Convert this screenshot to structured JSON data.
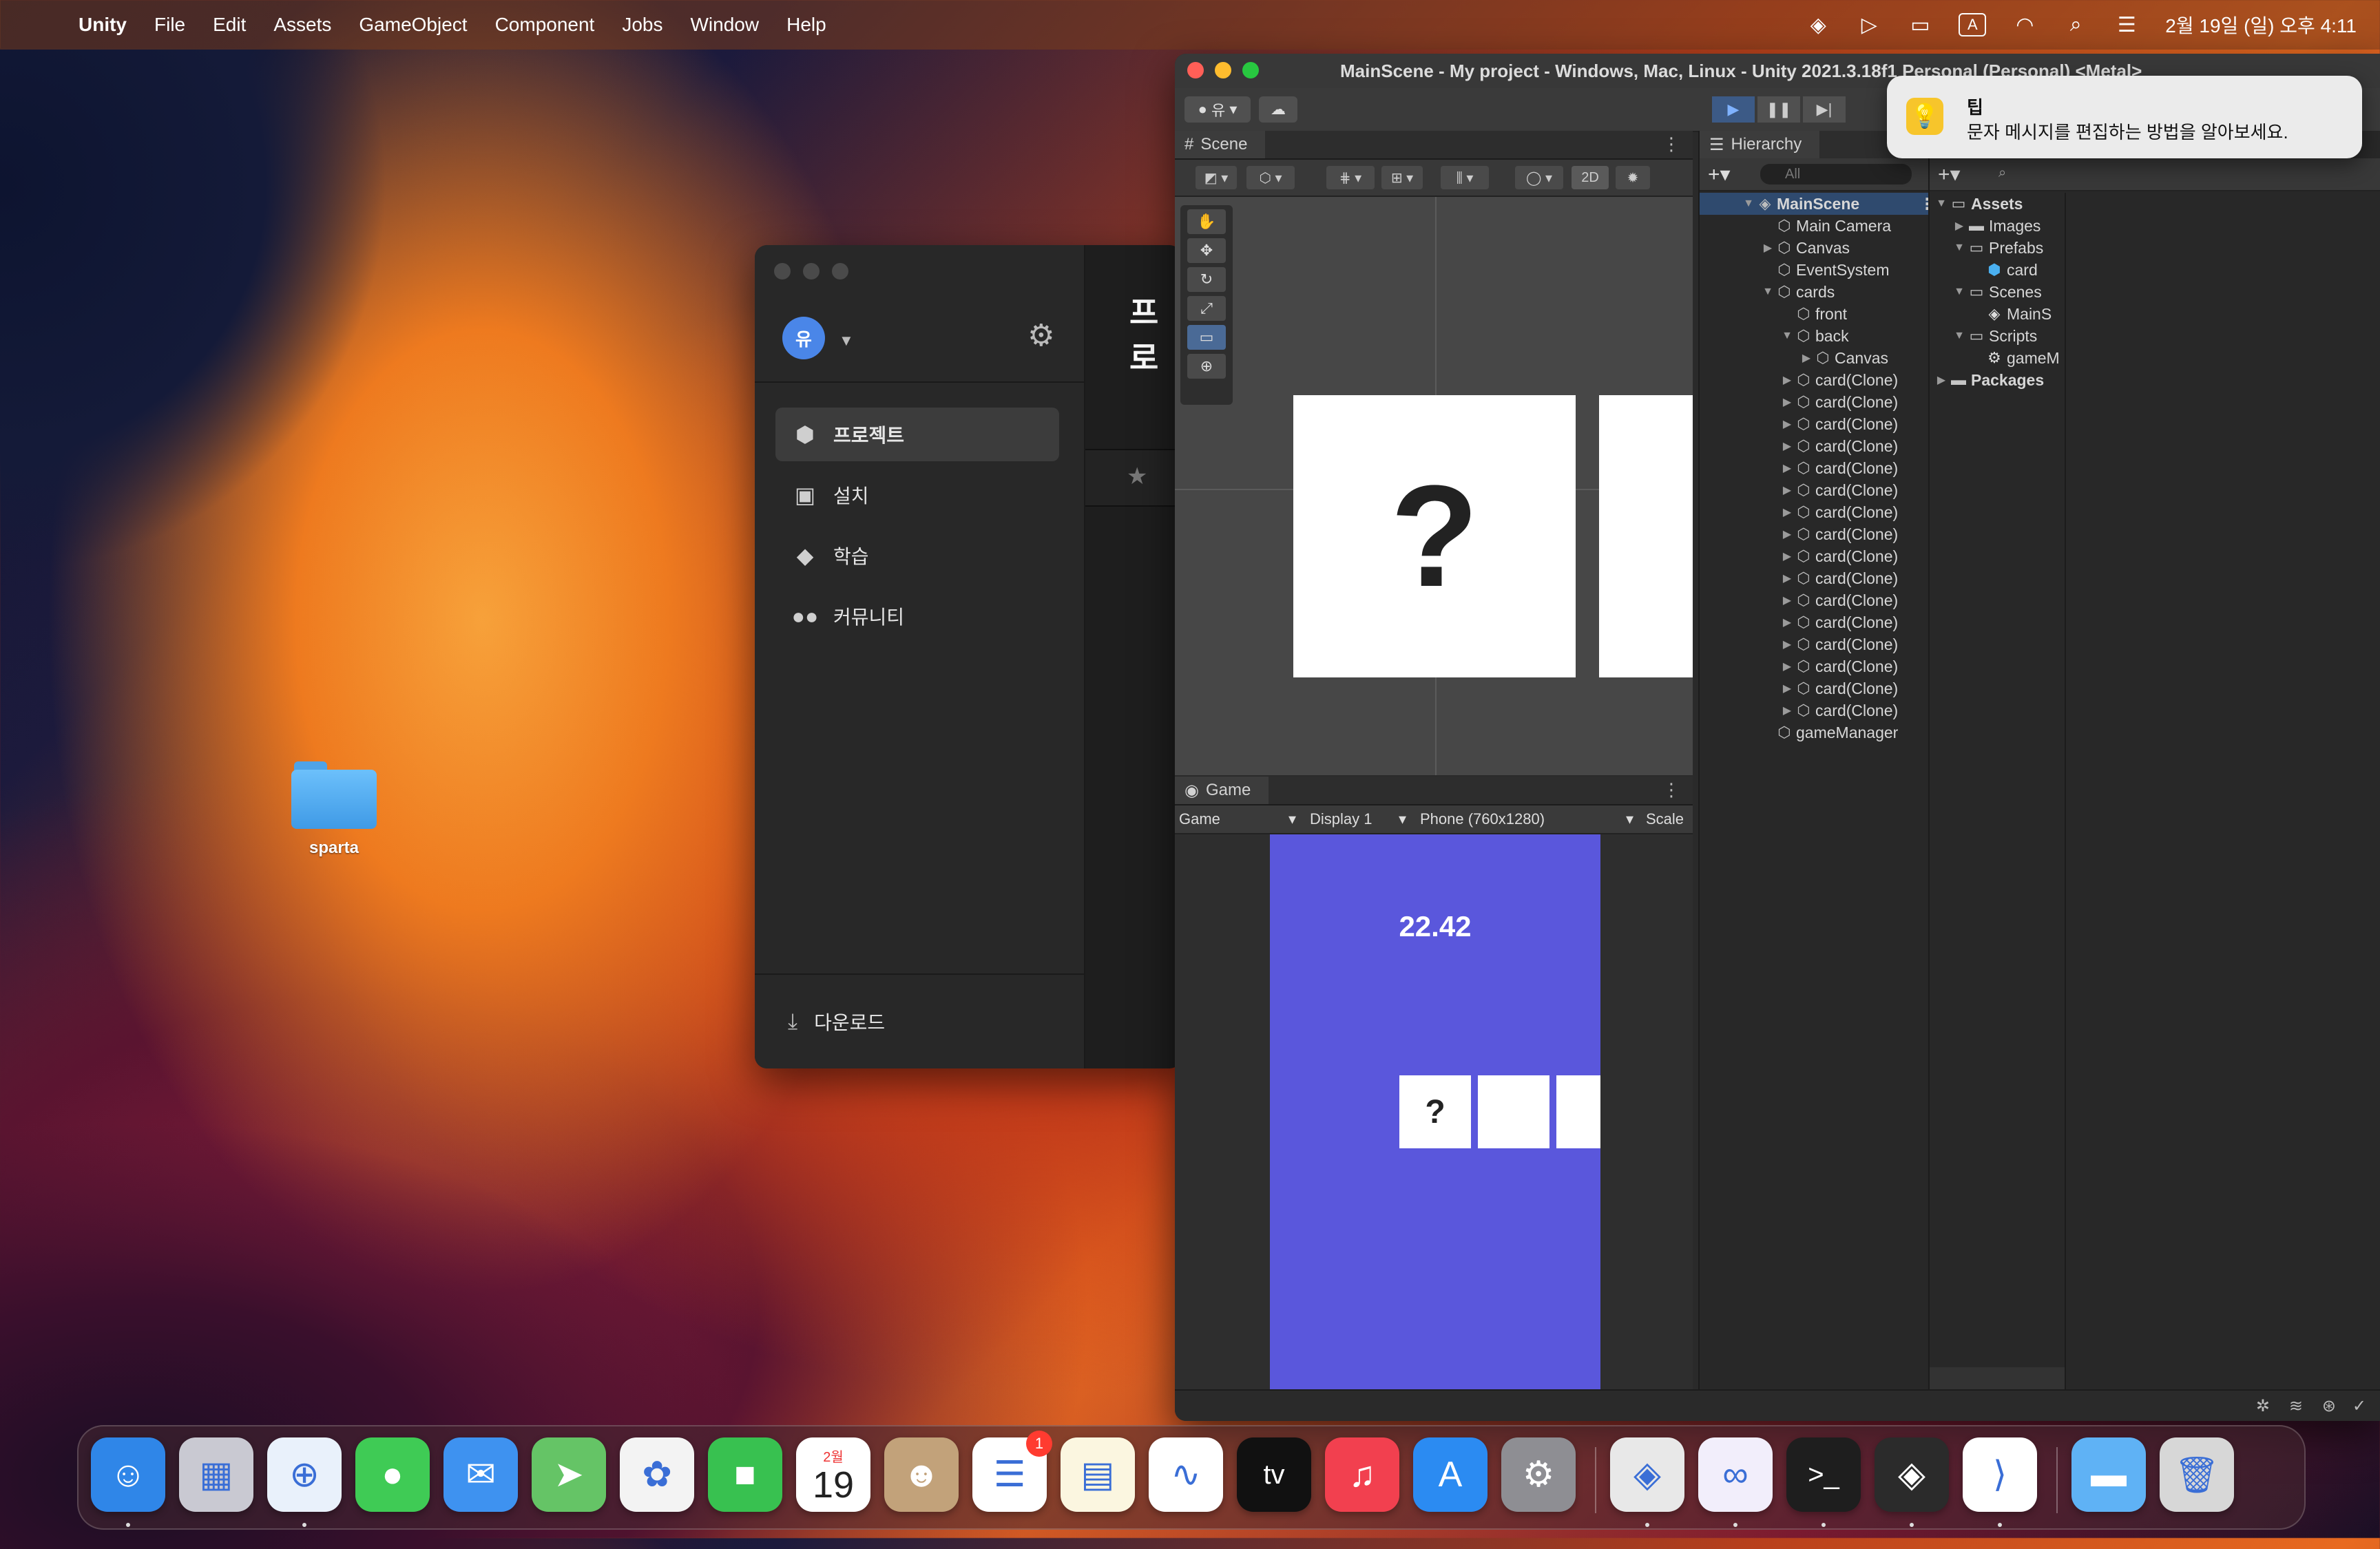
{
  "menubar": {
    "app": "Unity",
    "items": [
      "File",
      "Edit",
      "Assets",
      "GameObject",
      "Component",
      "Jobs",
      "Window",
      "Help"
    ],
    "input_indicator": "A",
    "datetime": "2월 19일 (일) 오후 4:11"
  },
  "desktop": {
    "folder_label": "sparta"
  },
  "hub": {
    "avatar_initial": "유",
    "title_partial": "프로",
    "nav": [
      {
        "label": "프로젝트",
        "icon": "cube-icon",
        "active": true
      },
      {
        "label": "설치",
        "icon": "lock-icon",
        "active": false
      },
      {
        "label": "학습",
        "icon": "graduation-cap-icon",
        "active": false
      },
      {
        "label": "커뮤니티",
        "icon": "people-icon",
        "active": false
      }
    ],
    "download_label": "다운로드"
  },
  "editor": {
    "title": "MainScene - My project - Windows, Mac, Linux - Unity 2021.3.18f1 Personal (Personal) <Metal>",
    "account_label": "유",
    "scene_tab": "Scene",
    "mode_2d": "2D",
    "game_tab": "Game",
    "game_bar": {
      "view": "Game",
      "display": "Display 1",
      "resolution": "Phone (760x1280)",
      "scale": "Scale"
    },
    "game": {
      "timer": "22.42",
      "card_symbol": "?"
    },
    "scene_card_symbol": "?",
    "hierarchy_tab": "Hierarchy",
    "hierarchy_search": "All",
    "hierarchy": [
      {
        "label": "MainScene",
        "depth": 0,
        "arrow": "▼",
        "scene": true
      },
      {
        "label": "Main Camera",
        "depth": 1,
        "arrow": ""
      },
      {
        "label": "Canvas",
        "depth": 1,
        "arrow": "▶"
      },
      {
        "label": "EventSystem",
        "depth": 1,
        "arrow": ""
      },
      {
        "label": "cards",
        "depth": 1,
        "arrow": "▼"
      },
      {
        "label": "front",
        "depth": 2,
        "arrow": ""
      },
      {
        "label": "back",
        "depth": 2,
        "arrow": "▼"
      },
      {
        "label": "Canvas",
        "depth": 3,
        "arrow": "▶"
      },
      {
        "label": "card(Clone)",
        "depth": 2,
        "arrow": "▶"
      },
      {
        "label": "card(Clone)",
        "depth": 2,
        "arrow": "▶"
      },
      {
        "label": "card(Clone)",
        "depth": 2,
        "arrow": "▶"
      },
      {
        "label": "card(Clone)",
        "depth": 2,
        "arrow": "▶"
      },
      {
        "label": "card(Clone)",
        "depth": 2,
        "arrow": "▶"
      },
      {
        "label": "card(Clone)",
        "depth": 2,
        "arrow": "▶"
      },
      {
        "label": "card(Clone)",
        "depth": 2,
        "arrow": "▶"
      },
      {
        "label": "card(Clone)",
        "depth": 2,
        "arrow": "▶"
      },
      {
        "label": "card(Clone)",
        "depth": 2,
        "arrow": "▶"
      },
      {
        "label": "card(Clone)",
        "depth": 2,
        "arrow": "▶"
      },
      {
        "label": "card(Clone)",
        "depth": 2,
        "arrow": "▶"
      },
      {
        "label": "card(Clone)",
        "depth": 2,
        "arrow": "▶"
      },
      {
        "label": "card(Clone)",
        "depth": 2,
        "arrow": "▶"
      },
      {
        "label": "card(Clone)",
        "depth": 2,
        "arrow": "▶"
      },
      {
        "label": "card(Clone)",
        "depth": 2,
        "arrow": "▶"
      },
      {
        "label": "card(Clone)",
        "depth": 2,
        "arrow": "▶"
      },
      {
        "label": "gameManager",
        "depth": 1,
        "arrow": ""
      }
    ],
    "project": [
      {
        "label": "Assets",
        "depth": 0,
        "arrow": "▼",
        "icon": "folder-open",
        "bold": true
      },
      {
        "label": "Images",
        "depth": 1,
        "arrow": "▶",
        "icon": "folder"
      },
      {
        "label": "Prefabs",
        "depth": 1,
        "arrow": "▼",
        "icon": "folder-open"
      },
      {
        "label": "card",
        "depth": 2,
        "arrow": "",
        "icon": "prefab"
      },
      {
        "label": "Scenes",
        "depth": 1,
        "arrow": "▼",
        "icon": "folder-open"
      },
      {
        "label": "MainS",
        "depth": 2,
        "arrow": "",
        "icon": "scene"
      },
      {
        "label": "Scripts",
        "depth": 1,
        "arrow": "▼",
        "icon": "folder-open"
      },
      {
        "label": "gameM",
        "depth": 2,
        "arrow": "",
        "icon": "script"
      },
      {
        "label": "Packages",
        "depth": 0,
        "arrow": "▶",
        "icon": "folder",
        "bold": true
      }
    ]
  },
  "notification": {
    "title": "팁",
    "message": "문자 메시지를 편집하는 방법을 알아보세요."
  },
  "dock": {
    "calendar_month": "2월",
    "calendar_day": "19",
    "reminders_badge": "1",
    "apps": [
      {
        "name": "finder-icon",
        "color": "#2f86e8",
        "glyph": "☺",
        "dot": true
      },
      {
        "name": "launchpad-icon",
        "color": "#c9c9d2",
        "glyph": "▦",
        "dot": false
      },
      {
        "name": "safari-icon",
        "color": "#e9f1fb",
        "glyph": "⊕",
        "dot": true
      },
      {
        "name": "messages-icon",
        "color": "#3fcb55",
        "glyph": "●",
        "dot": false
      },
      {
        "name": "mail-icon",
        "color": "#3e92f0",
        "glyph": "✉",
        "dot": false
      },
      {
        "name": "maps-icon",
        "color": "#65c466",
        "glyph": "➤",
        "dot": false
      },
      {
        "name": "photos-icon",
        "color": "#f3f3f3",
        "glyph": "✿",
        "dot": false
      },
      {
        "name": "facetime-icon",
        "color": "#38c150",
        "glyph": "■",
        "dot": false
      },
      {
        "name": "calendar-icon",
        "color": "#ffffff",
        "glyph": "",
        "dot": false
      },
      {
        "name": "contacts-icon",
        "color": "#c2a27a",
        "glyph": "☻",
        "dot": false
      },
      {
        "name": "reminders-icon",
        "color": "#ffffff",
        "glyph": "☰",
        "dot": false
      },
      {
        "name": "notes-icon",
        "color": "#fbf6e0",
        "glyph": "▤",
        "dot": false
      },
      {
        "name": "freeform-icon",
        "color": "#ffffff",
        "glyph": "∿",
        "dot": false
      },
      {
        "name": "apple-tv-icon",
        "color": "#111111",
        "glyph": "tv",
        "dot": false
      },
      {
        "name": "music-icon",
        "color": "#f2404f",
        "glyph": "♫",
        "dot": false
      },
      {
        "name": "app-store-icon",
        "color": "#2b8bf2",
        "glyph": "A",
        "dot": false
      },
      {
        "name": "system-settings-icon",
        "color": "#8e8e93",
        "glyph": "⚙",
        "dot": false
      },
      {
        "name": "unity-hub-icon",
        "color": "#e8e8e8",
        "glyph": "◈",
        "dot": true
      },
      {
        "name": "visual-studio-icon",
        "color": "#f2eefb",
        "glyph": "∞",
        "dot": true
      },
      {
        "name": "terminal-icon",
        "color": "#1e1e1e",
        "glyph": ">_",
        "dot": true
      },
      {
        "name": "unity-editor-icon",
        "color": "#2b2b2b",
        "glyph": "◈",
        "dot": true
      },
      {
        "name": "vscode-icon",
        "color": "#ffffff",
        "glyph": "⟩",
        "dot": true
      },
      {
        "name": "downloads-folder-icon",
        "color": "#5fb2f5",
        "glyph": "▬",
        "dot": false
      },
      {
        "name": "trash-icon",
        "color": "#d7d7d7",
        "glyph": "🗑",
        "dot": false
      }
    ]
  }
}
